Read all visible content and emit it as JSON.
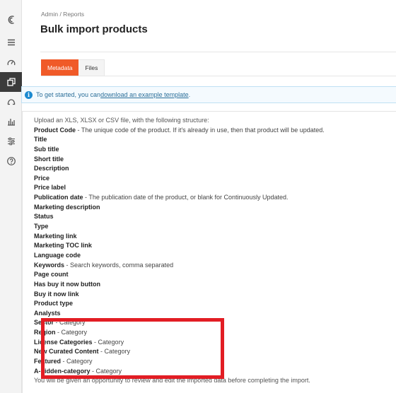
{
  "breadcrumb": "Admin / Reports",
  "title": "Bulk import products",
  "tabs": [
    {
      "label": "Metadata"
    },
    {
      "label": "Files"
    }
  ],
  "alert": {
    "prefix": "To get started, you can ",
    "link": "download an example template",
    "suffix": "."
  },
  "intro": "Upload an XLS, XLSX or CSV file, with the following structure:",
  "fields": [
    {
      "name": "Product Code",
      "desc": " - The unique code of the product. If it's already in use, then that product will be updated."
    },
    {
      "name": "Title",
      "desc": ""
    },
    {
      "name": "Sub title",
      "desc": ""
    },
    {
      "name": "Short title",
      "desc": ""
    },
    {
      "name": "Description",
      "desc": ""
    },
    {
      "name": "Price",
      "desc": ""
    },
    {
      "name": "Price label",
      "desc": ""
    },
    {
      "name": "Publication date",
      "desc": " - The publication date of the product, or blank for Continuously Updated."
    },
    {
      "name": "Marketing description",
      "desc": ""
    },
    {
      "name": "Status",
      "desc": ""
    },
    {
      "name": "Type",
      "desc": ""
    },
    {
      "name": "Marketing link",
      "desc": ""
    },
    {
      "name": "Marketing TOC link",
      "desc": ""
    },
    {
      "name": "Language code",
      "desc": ""
    },
    {
      "name": "Keywords",
      "desc": " - Search keywords, comma separated"
    },
    {
      "name": "Page count",
      "desc": ""
    },
    {
      "name": "Has buy it now button",
      "desc": ""
    },
    {
      "name": "Buy it now link",
      "desc": ""
    },
    {
      "name": "Product type",
      "desc": ""
    },
    {
      "name": "Analysts",
      "desc": ""
    },
    {
      "name": "Sector",
      "desc": " - Category"
    },
    {
      "name": "Region",
      "desc": " - Category"
    },
    {
      "name": "License Categories",
      "desc": " - Category"
    },
    {
      "name": "New Curated Content",
      "desc": " - Category"
    },
    {
      "name": "Featured",
      "desc": " - Category"
    },
    {
      "name": "A-hidden-category",
      "desc": " - Category"
    }
  ],
  "footer": "You will be given an opportunity to review and edit the imported data before completing the import.",
  "sidebar": {
    "icons": [
      "logo-icon",
      "menu-icon",
      "dashboard-icon",
      "products-icon",
      "support-icon",
      "reports-icon",
      "settings-icon",
      "help-icon"
    ]
  },
  "colors": {
    "accent": "#f05a28",
    "highlight": "#e21d24",
    "info": "#1c8ad0",
    "sidebar_active": "#3b3b3b"
  }
}
